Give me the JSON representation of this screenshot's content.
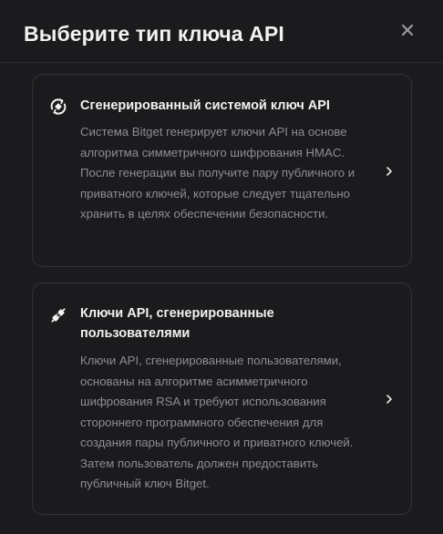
{
  "modal": {
    "title": "Выберите тип ключа API",
    "close_icon": "close-icon"
  },
  "options": [
    {
      "icon": "refresh-key-icon",
      "title": "Сгенерированный системой ключ API",
      "description": "Система Bitget генерирует ключи API на основе алгоритма симметричного шифрования HMAC. После генерации вы получите пару публичного и приватного ключей, которые следует тщательно хранить в целях обеспечении безопасности.",
      "chevron_icon": "chevron-right-icon"
    },
    {
      "icon": "plug-connect-icon",
      "title": "Ключи API, сгенерированные пользователями",
      "description": "Ключи API, сгенерированные пользователями, основаны на алгоритме асимметричного шифрования RSA и требуют использования стороннего программного обеспечения для создания пары публичного и приватного ключей. Затем пользователь должен предоставить публичный ключ Bitget.",
      "chevron_icon": "chevron-right-icon"
    }
  ]
}
